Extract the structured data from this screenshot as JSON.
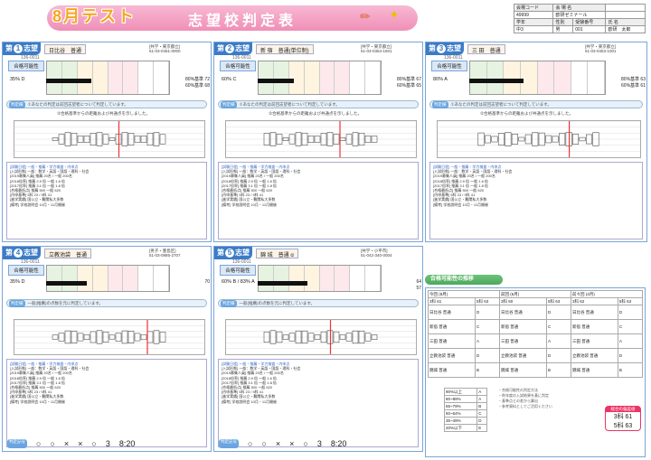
{
  "header": {
    "month_test": "8月テスト",
    "title": "志望校判定表"
  },
  "info": {
    "rows": [
      [
        "会場コード",
        "会 場 名",
        ""
      ],
      [
        "49999",
        "欧研ゼミナール",
        ""
      ],
      [
        "学年",
        "性別",
        "受験番号",
        "氏 名"
      ],
      [
        "中3",
        "男",
        "001",
        "欧研　太郎"
      ]
    ]
  },
  "panels": [
    {
      "choice_no": "1",
      "choice_label": "第",
      "choice_suffix": "志望",
      "school": "日比谷　普通",
      "exam_code": "136-0011",
      "region": "[共学・東京都立]",
      "tel": "51-03-0451-0000",
      "possibility_label": "合格可能性",
      "value": "35% D",
      "stat1": "80%基準 72",
      "stat2": "60%基準 68",
      "remark1": "①あなたの判定は前回志望者について判定しています。",
      "remark2": "②合格基準からの距離および共通点を示しました。"
    },
    {
      "choice_no": "2",
      "choice_label": "第",
      "choice_suffix": "志望",
      "school": "新 宿　普通(単位制)",
      "exam_code": "136-0011",
      "region": "[共学・東京都立]",
      "tel": "51-03-0354-1601",
      "possibility_label": "合格可能性",
      "value": "60% C",
      "stat1": "80%基準 67",
      "stat2": "60%基準 65",
      "remark1": "①あなたの判定は前回志望者について判定しています。",
      "remark2": "②合格基準からの距離および共通点を示しました。"
    },
    {
      "choice_no": "3",
      "choice_label": "第",
      "choice_suffix": "志望",
      "school": "三 田　普通",
      "exam_code": "136-0011",
      "region": "[共学・東京都立]",
      "tel": "51-03-0453-1001",
      "possibility_label": "合格可能性",
      "value": "80% A",
      "stat1": "80%基準 63",
      "stat2": "60%基準 61",
      "remark1": "①あなたの判定は前回志望者について判定しています。",
      "remark2": "②合格基準からの距離および共通点を示しました。"
    },
    {
      "choice_no": "4",
      "choice_label": "第",
      "choice_suffix": "志望",
      "school": "立教池袋　普通",
      "exam_code": "136-0011",
      "region": "[男子・豊島区]",
      "tel": "51-03-0985-2707",
      "possibility_label": "合格可能性",
      "value": "35% D",
      "stat1": "70",
      "stat2": "",
      "remark1": "一般(推薦)の点数を元に判定しています。",
      "remark2": ""
    },
    {
      "choice_no": "5",
      "choice_label": "第",
      "choice_suffix": "志望",
      "school": "錦 城　普通 α",
      "exam_code": "136-0011",
      "region": "[共学・小平市]",
      "tel": "51-042-340-0004",
      "possibility_label": "合格可能性",
      "value": "60% B / 83% A",
      "stat1": "64",
      "stat2": "57",
      "remark1": "一般(推薦)の点数を元に判定しています。",
      "remark2": ""
    }
  ],
  "summary": {
    "title": "合格可能性の推移",
    "cols": [
      "今回 (8月)",
      "前回 (6月)",
      "前々回 (4月)"
    ],
    "score_cols": [
      "3科 61",
      "3科 60",
      "3科 62"
    ],
    "score5": [
      "5科 63",
      "5科 63",
      "5科 63"
    ],
    "schools": [
      "日比谷 普通",
      "新宿 普通",
      "三田 普通",
      "立教池袋 普通",
      "錦城 普通"
    ],
    "grades": [
      "D",
      "C",
      "A",
      "D",
      "B"
    ],
    "legend_rows": [
      "90%以上",
      "80~89%",
      "65~79%",
      "50~64%",
      "35~49%",
      "20%以下"
    ],
    "legend_marks": [
      "A",
      "A",
      "B",
      "C",
      "D",
      "E"
    ],
    "final_label": "総合の偏差値",
    "final_3": "3科 61",
    "final_5": "5科 63"
  },
  "bottom_marks": [
    "○",
    "○",
    "×",
    "×",
    "○"
  ],
  "bottom_vals": [
    "3",
    "8:20"
  ]
}
